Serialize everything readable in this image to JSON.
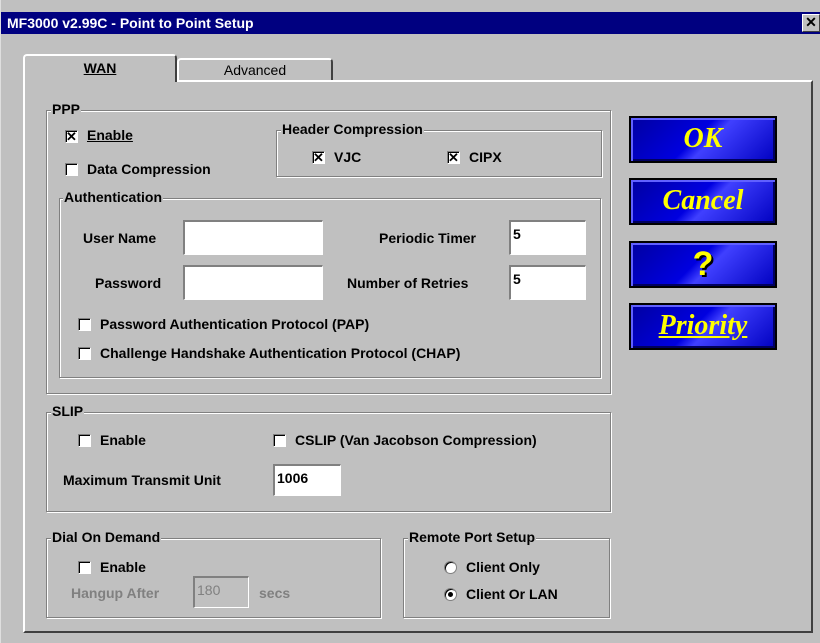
{
  "window": {
    "title": "MF3000 v2.99C - Point to Point Setup",
    "close": "✕"
  },
  "tabs": [
    {
      "label": "WAN"
    },
    {
      "label": "Advanced"
    }
  ],
  "ppp": {
    "title": "PPP",
    "enable": {
      "label": "Enable",
      "checked": true
    },
    "data_compression": {
      "label": "Data Compression",
      "checked": false
    },
    "header_compression": {
      "title": "Header Compression",
      "vjc": {
        "label": "VJC",
        "checked": true
      },
      "cipx": {
        "label": "CIPX",
        "checked": true
      }
    },
    "authentication": {
      "title": "Authentication",
      "user_name_label": "User Name",
      "user_name_value": "",
      "password_label": "Password",
      "password_value": "",
      "periodic_timer_label": "Periodic Timer",
      "periodic_timer_value": "5",
      "retries_label": "Number of Retries",
      "retries_value": "5",
      "pap": {
        "label": "Password Authentication Protocol (PAP)",
        "checked": false
      },
      "chap": {
        "label": "Challenge Handshake Authentication Protocol (CHAP)",
        "checked": false
      }
    }
  },
  "slip": {
    "title": "SLIP",
    "enable": {
      "label": "Enable",
      "checked": false
    },
    "cslip": {
      "label": "CSLIP (Van Jacobson Compression)",
      "checked": false
    },
    "mtu_label": "Maximum Transmit Unit",
    "mtu_value": "1006"
  },
  "dial_on_demand": {
    "title": "Dial On Demand",
    "enable": {
      "label": "Enable",
      "checked": false
    },
    "hangup_label": "Hangup After",
    "hangup_value": "180",
    "secs_label": "secs"
  },
  "remote_port": {
    "title": "Remote Port Setup",
    "options": [
      {
        "label": "Client Only",
        "selected": false
      },
      {
        "label": "Client Or LAN",
        "selected": true
      }
    ]
  },
  "buttons": {
    "ok": "OK",
    "cancel": "Cancel",
    "help": "?",
    "priority": "Priority"
  },
  "colors": {
    "title_bg": "#000080",
    "face": "#c0c0c0",
    "button_bg": "#0000e0",
    "button_text": "#ffff00"
  }
}
